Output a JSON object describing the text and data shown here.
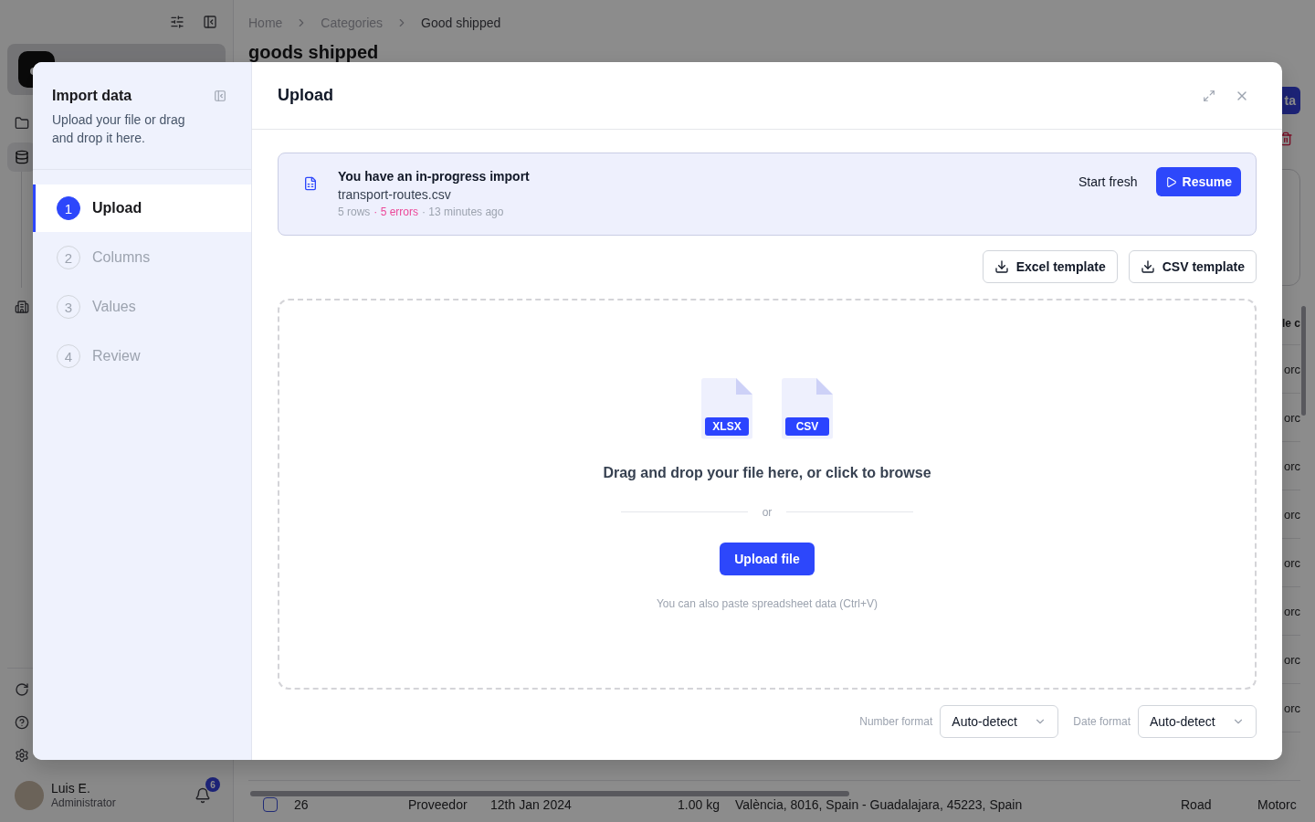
{
  "sidebar": {
    "nav": [
      {
        "selected": false
      },
      {
        "selected": true
      },
      {
        "selected": false
      }
    ],
    "user": {
      "name": "Luis E.",
      "role": "Administrator",
      "notifications": "6"
    }
  },
  "page": {
    "breadcrumb": [
      {
        "label": "Home",
        "current": false
      },
      {
        "label": "Categories",
        "current": false
      },
      {
        "label": "Good shipped",
        "current": true
      }
    ],
    "title": "goods shipped",
    "action_button": "ta",
    "table": {
      "header_fragment": "le c",
      "row_fragments": [
        "orc",
        "orc",
        "orc",
        "orc",
        "orc",
        "orc",
        "orc",
        "orc"
      ],
      "rows": [
        {
          "checked": false,
          "cells": [
            "26",
            "Proveedor",
            "12th Jan 2024",
            "1.00 kg",
            "València, 8016, Spain - Guadalajara, 45223, Spain",
            "Road",
            "Motorc"
          ]
        }
      ]
    }
  },
  "dialog": {
    "sidebar": {
      "title": "Import data",
      "description": "Upload your file or drag and drop it here.",
      "steps": [
        {
          "number": "1",
          "label": "Upload",
          "selected": true
        },
        {
          "number": "2",
          "label": "Columns",
          "selected": false
        },
        {
          "number": "3",
          "label": "Values",
          "selected": false
        },
        {
          "number": "4",
          "label": "Review",
          "selected": false
        }
      ]
    },
    "title": "Upload",
    "resume_banner": {
      "title": "You have an in-progress import",
      "file_name": "transport-routes.csv",
      "meta": [
        {
          "text": "5 rows",
          "kind": "info"
        },
        {
          "text": "· 5 errors",
          "kind": "error"
        },
        {
          "text": "· 13 minutes ago",
          "kind": "info"
        }
      ],
      "secondary_action": "Start fresh",
      "primary_action": "Resume"
    },
    "templates": [
      "Excel template",
      "CSV template"
    ],
    "dropzone": {
      "file_types": [
        "XLSX",
        "CSV"
      ],
      "prompt": "Drag and drop your file here, or click to browse",
      "divider": "or",
      "button": "Upload file",
      "hint": "You can also paste spreadsheet data (Ctrl+V)"
    },
    "options": [
      {
        "label": "Number format",
        "value": "Auto-detect"
      },
      {
        "label": "Date format",
        "value": "Auto-detect"
      }
    ]
  }
}
